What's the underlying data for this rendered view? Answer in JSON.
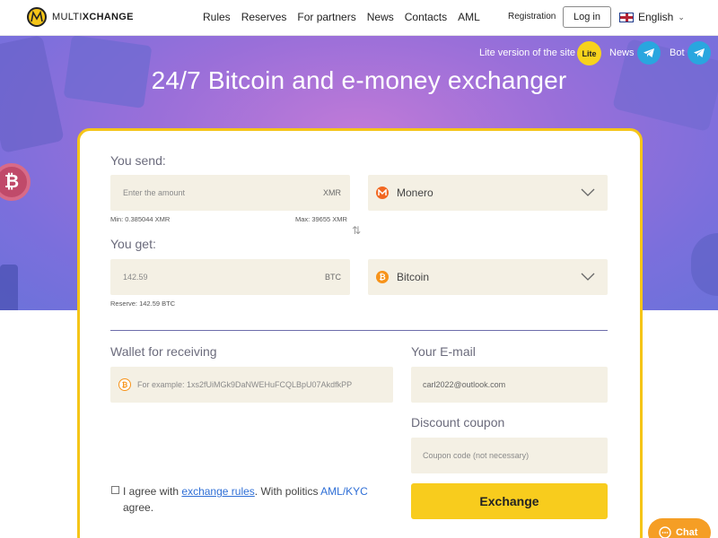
{
  "header": {
    "logo_text_light": "MULTI",
    "logo_text_bold": "XCHANGE",
    "nav": [
      "Rules",
      "Reserves",
      "For partners",
      "News",
      "Contacts",
      "AML"
    ],
    "registration": "Registration",
    "login": "Log in",
    "language": "English"
  },
  "hero": {
    "lite_link": "Lite version of the site",
    "lite_badge": "Lite",
    "news": "News",
    "bot": "Bot",
    "title": "24/7 Bitcoin and e-money exchanger"
  },
  "send": {
    "label": "You send:",
    "amount_placeholder": "Enter the amount",
    "currency_code": "XMR",
    "min": "Min: 0.385044 XMR",
    "max": "Max: 39655 XMR",
    "selected_currency": "Monero"
  },
  "get": {
    "label": "You get:",
    "amount": "142.59",
    "currency_code": "BTC",
    "reserve": "Reserve: 142.59 BTC",
    "selected_currency": "Bitcoin"
  },
  "wallet": {
    "label": "Wallet for receiving",
    "placeholder": "For example: 1xs2fUiMGk9DaNWEHuFCQLBpU07AkdfkPP"
  },
  "email": {
    "label": "Your E-mail",
    "value": "carl2022@outlook.com"
  },
  "coupon": {
    "label": "Discount coupon",
    "placeholder": "Coupon code (not necessary)"
  },
  "agreement": {
    "text1": "I agree with",
    "rules_link": "exchange rules",
    "text2": ". With politics",
    "aml_link": "AML/KYC",
    "text3": "agree."
  },
  "exchange_button": "Exchange",
  "chat_button": "Chat",
  "colors": {
    "accent_yellow": "#f8cc1d",
    "hero_purple": "#7b6fdc",
    "link_blue": "#2f6fd6",
    "telegram_blue": "#29a6df",
    "monero_orange": "#f26822",
    "bitcoin_orange": "#f7931a",
    "chat_orange": "#f59e25"
  }
}
